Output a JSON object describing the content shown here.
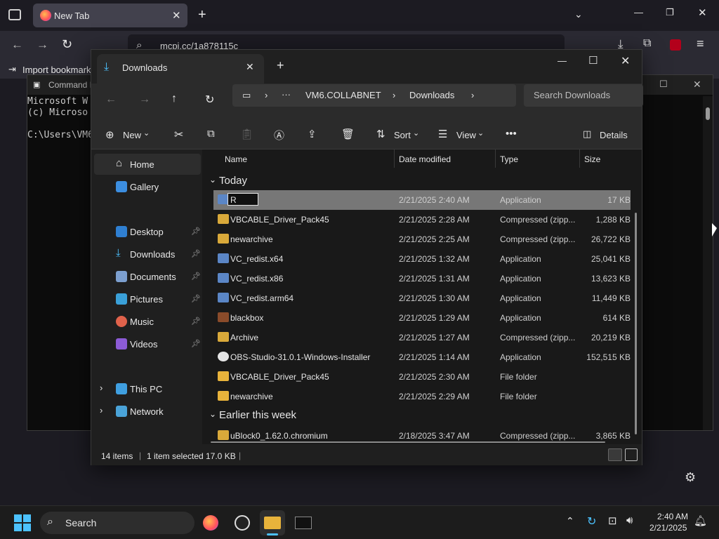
{
  "browser": {
    "tab_title": "New Tab",
    "url": "mcpi.cc/1a878115c",
    "bookmark_import": "Import bookmarks"
  },
  "cmd": {
    "title": "Command P",
    "lines": [
      "Microsoft W",
      "(c) Microso",
      "",
      "C:\\Users\\VM6"
    ]
  },
  "explorer": {
    "tab_title": "Downloads",
    "breadcrumb": [
      "VM6.COLLABNET",
      "Downloads"
    ],
    "search_placeholder": "Search Downloads",
    "toolbar": {
      "new_label": "New",
      "sort_label": "Sort",
      "view_label": "View",
      "details_label": "Details",
      "more_label": "•••"
    },
    "nav": [
      {
        "label": "Home",
        "icon": "home-icon"
      },
      {
        "label": "Gallery",
        "icon": "gallery-icon"
      },
      {
        "label": "Desktop",
        "icon": "desktop-icon"
      },
      {
        "label": "Downloads",
        "icon": "download-icon"
      },
      {
        "label": "Documents",
        "icon": "documents-icon"
      },
      {
        "label": "Pictures",
        "icon": "pictures-icon"
      },
      {
        "label": "Music",
        "icon": "music-icon"
      },
      {
        "label": "Videos",
        "icon": "videos-icon"
      },
      {
        "label": "This PC",
        "icon": "pc-icon"
      },
      {
        "label": "Network",
        "icon": "network-icon"
      }
    ],
    "columns": [
      "Name",
      "Date modified",
      "Type",
      "Size"
    ],
    "groups": [
      "Today",
      "Earlier this week"
    ],
    "rename_value": "R",
    "rows": [
      {
        "name": "R",
        "date": "2/21/2025 2:40 AM",
        "type": "Application",
        "size": "17 KB",
        "kind": "app"
      },
      {
        "name": "VBCABLE_Driver_Pack45",
        "date": "2/21/2025 2:28 AM",
        "type": "Compressed (zipp...",
        "size": "1,288 KB",
        "kind": "zip"
      },
      {
        "name": "newarchive",
        "date": "2/21/2025 2:25 AM",
        "type": "Compressed (zipp...",
        "size": "26,722 KB",
        "kind": "zip"
      },
      {
        "name": "VC_redist.x64",
        "date": "2/21/2025 1:32 AM",
        "type": "Application",
        "size": "25,041 KB",
        "kind": "app"
      },
      {
        "name": "VC_redist.x86",
        "date": "2/21/2025 1:31 AM",
        "type": "Application",
        "size": "13,623 KB",
        "kind": "app"
      },
      {
        "name": "VC_redist.arm64",
        "date": "2/21/2025 1:30 AM",
        "type": "Application",
        "size": "11,449 KB",
        "kind": "app"
      },
      {
        "name": "blackbox",
        "date": "2/21/2025 1:29 AM",
        "type": "Application",
        "size": "614 KB",
        "kind": "app"
      },
      {
        "name": "Archive",
        "date": "2/21/2025 1:27 AM",
        "type": "Compressed (zipp...",
        "size": "20,219 KB",
        "kind": "zip"
      },
      {
        "name": "OBS-Studio-31.0.1-Windows-Installer",
        "date": "2/21/2025 1:14 AM",
        "type": "Application",
        "size": "152,515 KB",
        "kind": "app"
      },
      {
        "name": "VBCABLE_Driver_Pack45",
        "date": "2/21/2025 2:30 AM",
        "type": "File folder",
        "size": "",
        "kind": "folder"
      },
      {
        "name": "newarchive",
        "date": "2/21/2025 2:29 AM",
        "type": "File folder",
        "size": "",
        "kind": "folder"
      },
      {
        "name": "uBlock0_1.62.0.chromium",
        "date": "2/18/2025 3:47 AM",
        "type": "Compressed (zipp...",
        "size": "3,865 KB",
        "kind": "zip"
      }
    ],
    "status": {
      "items": "14 items",
      "selected": "1 item selected",
      "size": "17.0 KB"
    }
  },
  "taskbar": {
    "search_label": "Search",
    "time": "2:40 AM",
    "date": "2/21/2025"
  }
}
